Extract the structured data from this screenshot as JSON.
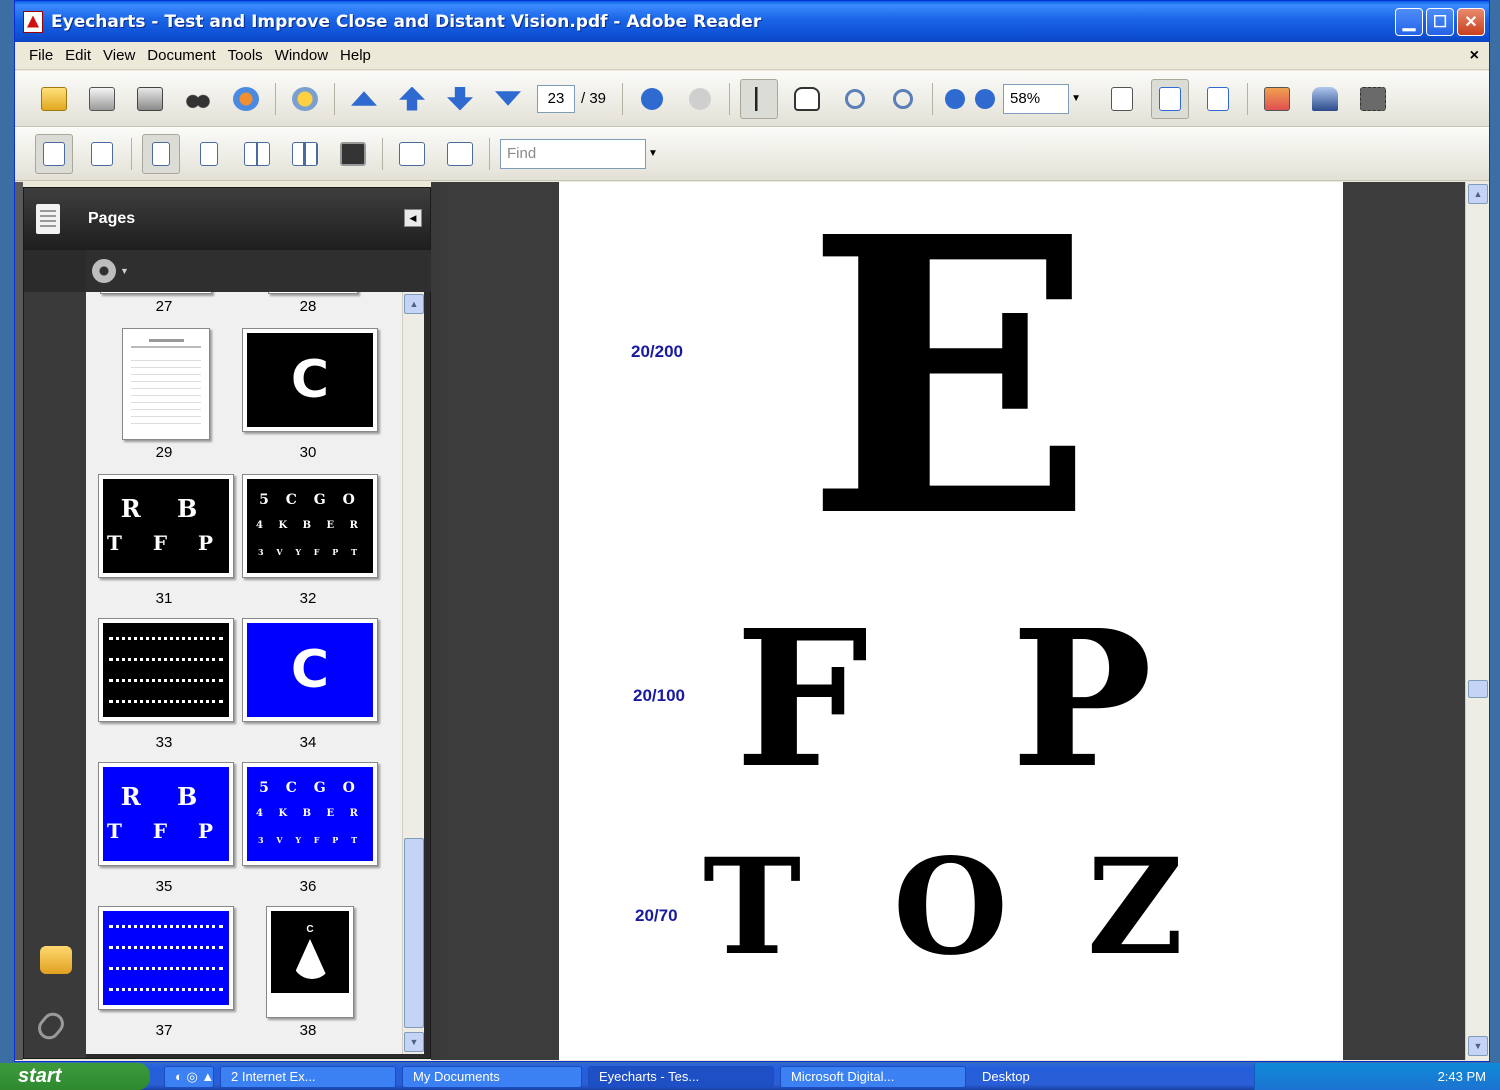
{
  "window": {
    "title": "Eyecharts - Test and Improve Close and Distant Vision.pdf - Adobe Reader"
  },
  "menu": {
    "items": [
      "File",
      "Edit",
      "View",
      "Document",
      "Tools",
      "Window",
      "Help"
    ],
    "close_glyph": "×"
  },
  "toolbar": {
    "current_page": "23",
    "total_pages": "/ 39",
    "zoom": "58%",
    "find_placeholder": "Find"
  },
  "panel": {
    "title": "Pages",
    "thumbnails": [
      {
        "num": "27"
      },
      {
        "num": "28"
      },
      {
        "num": "29"
      },
      {
        "num": "30",
        "text": "C"
      },
      {
        "num": "31",
        "line1": "R B",
        "line2": "T F P"
      },
      {
        "num": "32",
        "line1": "5 C G O",
        "line2": "4 K B E R",
        "line3": "3 V Y F P T"
      },
      {
        "num": "33"
      },
      {
        "num": "34",
        "text": "C"
      },
      {
        "num": "35",
        "line1": "R B",
        "line2": "T F P"
      },
      {
        "num": "36",
        "line1": "5 C G O",
        "line2": "4 K B E R",
        "line3": "3 V Y F P T"
      },
      {
        "num": "37"
      },
      {
        "num": "38",
        "text": "C"
      }
    ]
  },
  "document": {
    "rows": [
      {
        "acuity": "20/200",
        "letters": [
          "E"
        ]
      },
      {
        "acuity": "20/100",
        "letters": [
          "F",
          "P"
        ]
      },
      {
        "acuity": "20/70",
        "letters": [
          "T",
          "O",
          "Z"
        ]
      }
    ]
  },
  "taskbar": {
    "start": "start",
    "tasks": [
      "2 Internet Ex...",
      "My Documents",
      "Eyecharts - Tes...",
      "Microsoft Digital...",
      "Desktop"
    ],
    "clock": "2:43 PM"
  },
  "colors": {
    "acuity_label": "#1a1aa0",
    "thumb_blue": "#0000ff",
    "titlebar": "#0f52d6"
  }
}
